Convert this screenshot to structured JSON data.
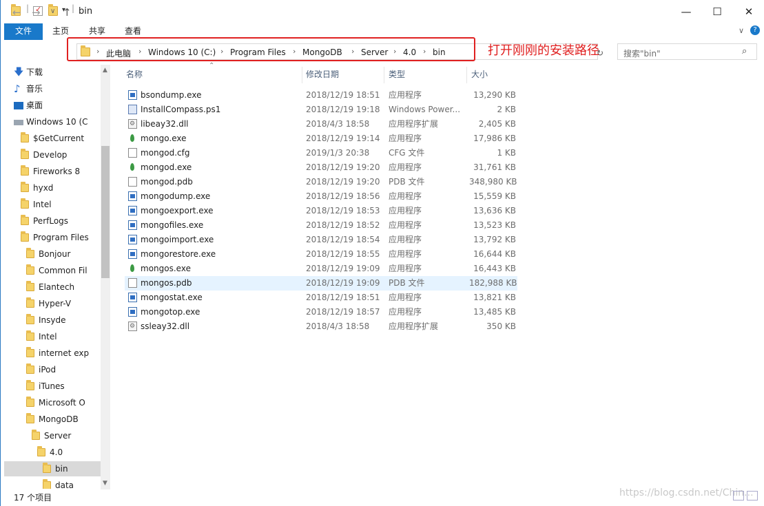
{
  "window": {
    "title": "bin",
    "controls": {
      "minimize": "—",
      "maximize": "☐",
      "close": "✕"
    }
  },
  "ribbon": {
    "tabs": [
      "文件",
      "主页",
      "共享",
      "查看"
    ],
    "help": "?"
  },
  "address": {
    "breadcrumbs": [
      "此电脑",
      "Windows 10 (C:)",
      "Program Files",
      "MongoDB",
      "Server",
      "4.0",
      "bin"
    ],
    "annotation": "打开刚刚的安装路径"
  },
  "search": {
    "placeholder": "搜索\"bin\""
  },
  "sidebar": {
    "items": [
      {
        "label": "下载",
        "icon": "download-arrow-icon"
      },
      {
        "label": "音乐",
        "icon": "music-note-icon"
      },
      {
        "label": "桌面",
        "icon": "desktop-icon"
      },
      {
        "label": "Windows 10 (C",
        "icon": "drive-icon"
      },
      {
        "label": "$GetCurrent",
        "icon": "folder-icon"
      },
      {
        "label": "Develop",
        "icon": "folder-icon"
      },
      {
        "label": "Fireworks 8",
        "icon": "folder-icon"
      },
      {
        "label": "hyxd",
        "icon": "folder-icon"
      },
      {
        "label": "Intel",
        "icon": "folder-icon"
      },
      {
        "label": "PerfLogs",
        "icon": "folder-icon"
      },
      {
        "label": "Program Files",
        "icon": "folder-icon"
      },
      {
        "label": "Bonjour",
        "icon": "folder-icon"
      },
      {
        "label": "Common Fil",
        "icon": "folder-icon"
      },
      {
        "label": "Elantech",
        "icon": "folder-icon"
      },
      {
        "label": "Hyper-V",
        "icon": "folder-icon"
      },
      {
        "label": "Insyde",
        "icon": "folder-icon"
      },
      {
        "label": "Intel",
        "icon": "folder-icon"
      },
      {
        "label": "internet exp",
        "icon": "folder-icon"
      },
      {
        "label": "iPod",
        "icon": "folder-icon"
      },
      {
        "label": "iTunes",
        "icon": "folder-icon"
      },
      {
        "label": "Microsoft O",
        "icon": "folder-icon"
      },
      {
        "label": "MongoDB",
        "icon": "folder-icon"
      },
      {
        "label": "Server",
        "icon": "folder-icon"
      },
      {
        "label": "4.0",
        "icon": "folder-icon"
      },
      {
        "label": "bin",
        "icon": "folder-icon"
      },
      {
        "label": "data",
        "icon": "folder-icon"
      }
    ]
  },
  "columns": {
    "name": "名称",
    "date": "修改日期",
    "type": "类型",
    "size": "大小"
  },
  "files": [
    {
      "name": "bsondump.exe",
      "date": "2018/12/19 18:51",
      "type": "应用程序",
      "size": "13,290 KB",
      "icon": "exe"
    },
    {
      "name": "InstallCompass.ps1",
      "date": "2018/12/19 19:18",
      "type": "Windows Power...",
      "size": "2 KB",
      "icon": "ps"
    },
    {
      "name": "libeay32.dll",
      "date": "2018/4/3 18:58",
      "type": "应用程序扩展",
      "size": "2,405 KB",
      "icon": "dll"
    },
    {
      "name": "mongo.exe",
      "date": "2018/12/19 19:14",
      "type": "应用程序",
      "size": "17,986 KB",
      "icon": "leaf"
    },
    {
      "name": "mongod.cfg",
      "date": "2019/1/3 20:38",
      "type": "CFG 文件",
      "size": "1 KB",
      "icon": "doc"
    },
    {
      "name": "mongod.exe",
      "date": "2018/12/19 19:20",
      "type": "应用程序",
      "size": "31,761 KB",
      "icon": "leaf"
    },
    {
      "name": "mongod.pdb",
      "date": "2018/12/19 19:20",
      "type": "PDB 文件",
      "size": "348,980 KB",
      "icon": "doc"
    },
    {
      "name": "mongodump.exe",
      "date": "2018/12/19 18:56",
      "type": "应用程序",
      "size": "15,559 KB",
      "icon": "exe"
    },
    {
      "name": "mongoexport.exe",
      "date": "2018/12/19 18:53",
      "type": "应用程序",
      "size": "13,636 KB",
      "icon": "exe"
    },
    {
      "name": "mongofiles.exe",
      "date": "2018/12/19 18:52",
      "type": "应用程序",
      "size": "13,523 KB",
      "icon": "exe"
    },
    {
      "name": "mongoimport.exe",
      "date": "2018/12/19 18:54",
      "type": "应用程序",
      "size": "13,792 KB",
      "icon": "exe"
    },
    {
      "name": "mongorestore.exe",
      "date": "2018/12/19 18:55",
      "type": "应用程序",
      "size": "16,644 KB",
      "icon": "exe"
    },
    {
      "name": "mongos.exe",
      "date": "2018/12/19 19:09",
      "type": "应用程序",
      "size": "16,443 KB",
      "icon": "leaf"
    },
    {
      "name": "mongos.pdb",
      "date": "2018/12/19 19:09",
      "type": "PDB 文件",
      "size": "182,988 KB",
      "icon": "doc",
      "selected": true
    },
    {
      "name": "mongostat.exe",
      "date": "2018/12/19 18:51",
      "type": "应用程序",
      "size": "13,821 KB",
      "icon": "exe"
    },
    {
      "name": "mongotop.exe",
      "date": "2018/12/19 18:57",
      "type": "应用程序",
      "size": "13,485 KB",
      "icon": "exe"
    },
    {
      "name": "ssleay32.dll",
      "date": "2018/4/3 18:58",
      "type": "应用程序扩展",
      "size": "350 KB",
      "icon": "dll"
    }
  ],
  "status": {
    "count": "17 个项目"
  },
  "watermark": "https://blog.csdn.net/Chin..."
}
